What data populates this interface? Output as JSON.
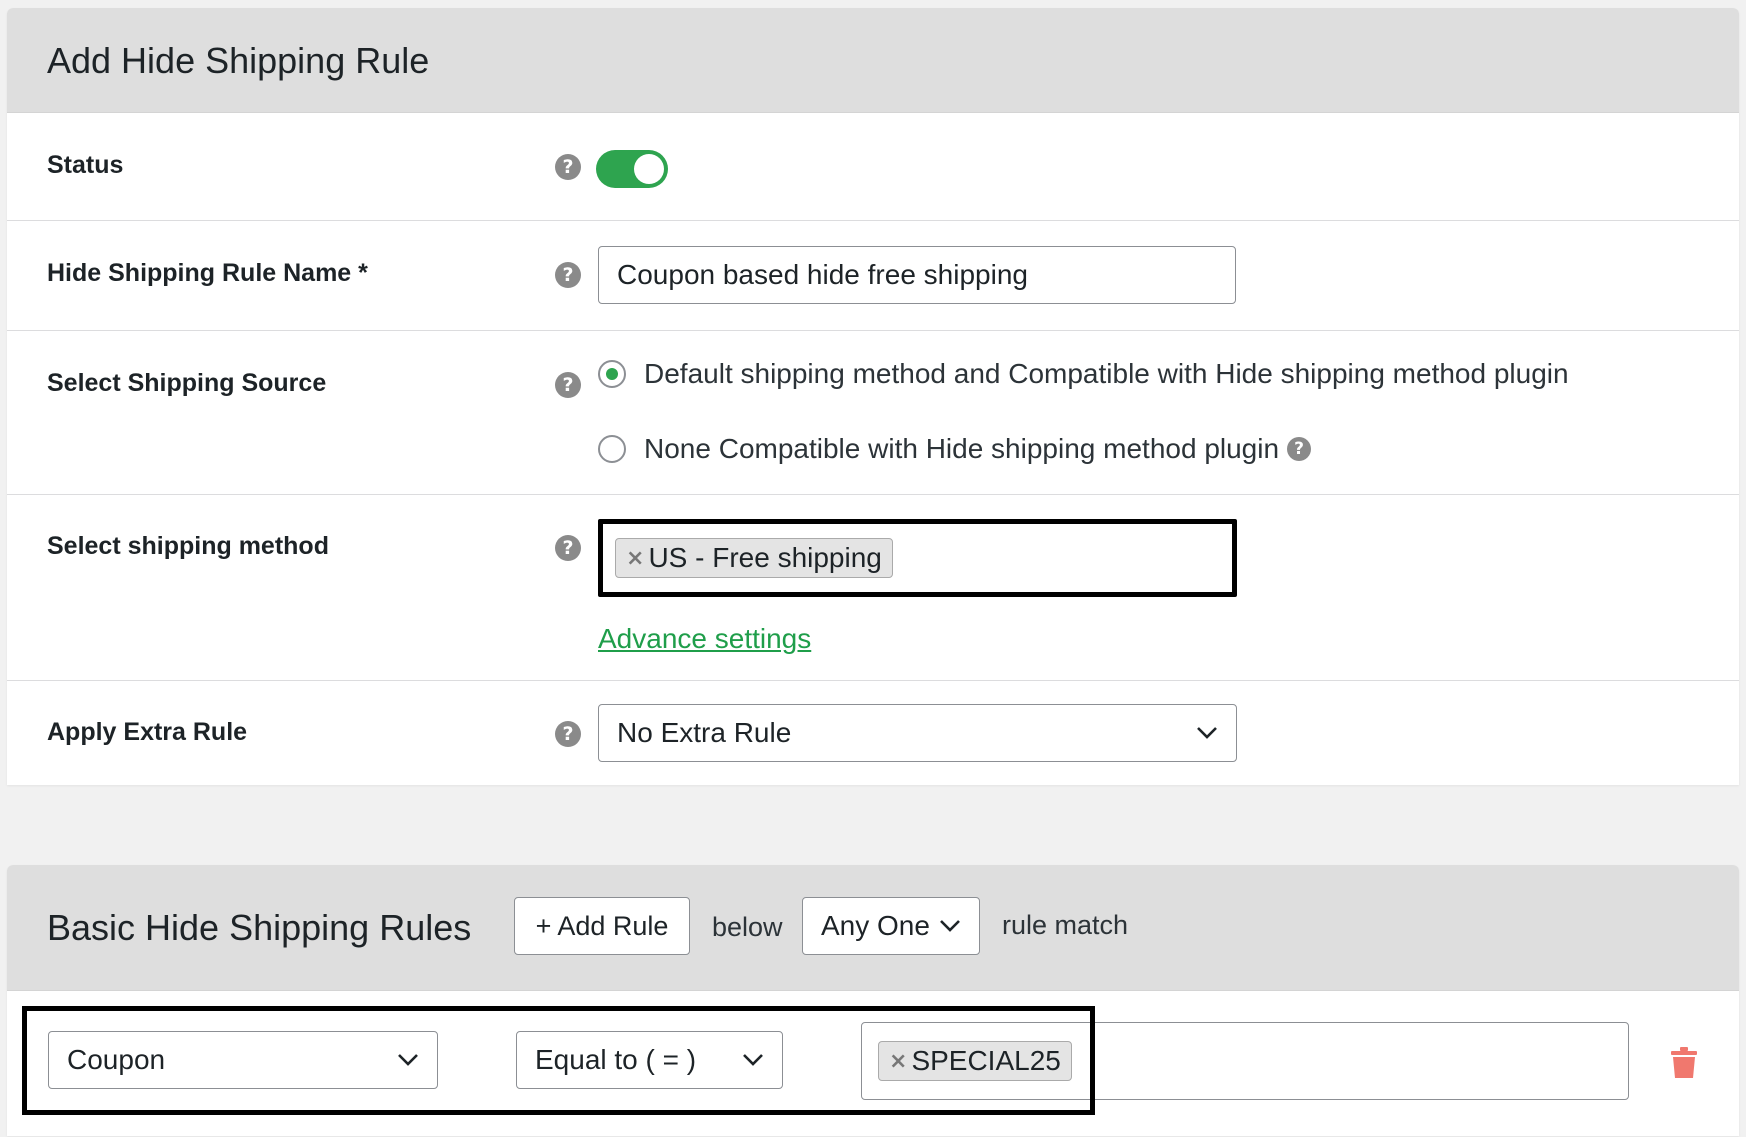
{
  "panel1": {
    "title": "Add Hide Shipping Rule",
    "status": {
      "label": "Status",
      "enabled": true
    },
    "rule_name": {
      "label": "Hide Shipping Rule Name *",
      "value": "Coupon based hide free shipping"
    },
    "shipping_source": {
      "label": "Select Shipping Source",
      "options": [
        {
          "label": "Default shipping method and Compatible with Hide shipping method plugin",
          "checked": true
        },
        {
          "label": "None Compatible with Hide shipping method plugin",
          "checked": false
        }
      ]
    },
    "shipping_method": {
      "label": "Select shipping method",
      "chip": "US - Free shipping",
      "chip_remove": "×",
      "advance_link": "Advance settings"
    },
    "extra_rule": {
      "label": "Apply Extra Rule",
      "selected": "No Extra Rule"
    }
  },
  "panel2": {
    "title": "Basic Hide Shipping Rules",
    "add_rule": "+ Add Rule",
    "below": "below",
    "match_select": "Any One",
    "rule_match": "rule match",
    "rule": {
      "condition": "Coupon",
      "operator": "Equal to ( = )",
      "value_chip": "SPECIAL25",
      "chip_remove": "×"
    }
  },
  "help_glyph": "?",
  "colors": {
    "accent": "#2ea44f",
    "link": "#1f9e4a",
    "delete": "#f0786e",
    "header_bg": "#dedede"
  }
}
